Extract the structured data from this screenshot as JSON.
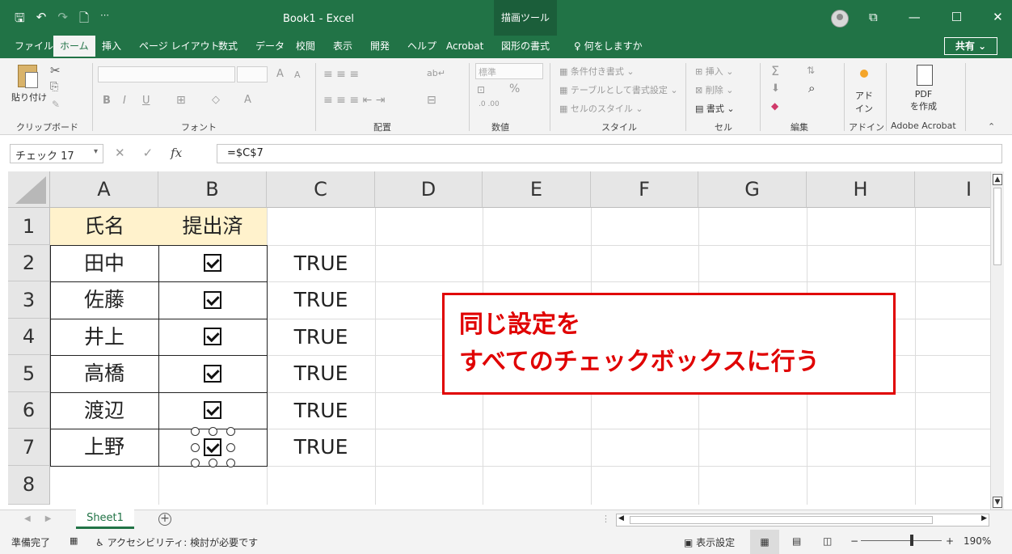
{
  "app": {
    "title": "Book1  -  Excel",
    "draw_tools": "描画ツール",
    "quick_access": {
      "save": "🖫",
      "undo": "↶",
      "redo": "↷",
      "new": "🗋",
      "more": "⋯"
    },
    "window_buttons": {
      "ribbon_display": "⧉",
      "minimize": "—",
      "maximize": "☐",
      "close": "✕"
    }
  },
  "tabs": [
    {
      "label": "ファイル"
    },
    {
      "label": "ホーム"
    },
    {
      "label": "挿入"
    },
    {
      "label": "ページ レイアウト"
    },
    {
      "label": "数式"
    },
    {
      "label": "データ"
    },
    {
      "label": "校閲"
    },
    {
      "label": "表示"
    },
    {
      "label": "開発"
    },
    {
      "label": "ヘルプ"
    },
    {
      "label": "Acrobat"
    },
    {
      "label": "図形の書式"
    }
  ],
  "tell_me": "何をしますか",
  "share": "共有",
  "ribbon": {
    "clipboard": {
      "paste": "貼り付け",
      "label": "クリップボード"
    },
    "font": {
      "label": "フォント",
      "bold": "B",
      "italic": "I",
      "underline": "U",
      "grow": "A",
      "shrink": "A"
    },
    "alignment": {
      "label": "配置"
    },
    "number": {
      "format": "標準",
      "label": "数値",
      "percent": "%"
    },
    "styles": {
      "conditional": "条件付き書式",
      "table": "テーブルとして書式設定",
      "cell_styles": "セルのスタイル",
      "label": "スタイル"
    },
    "cells": {
      "insert": "挿入",
      "delete": "削除",
      "format": "書式",
      "label": "セル"
    },
    "editing": {
      "label": "編集",
      "sum": "Σ"
    },
    "addin": {
      "name": "アド\nイン",
      "label": "アドイン"
    },
    "acrobat": {
      "name": "PDF\nを作成",
      "label": "Adobe Acrobat"
    }
  },
  "formula_bar": {
    "name_box": "チェック 17",
    "cancel": "✕",
    "enter": "✓",
    "fx": "fx",
    "formula": "=$C$7"
  },
  "columns": [
    "A",
    "B",
    "C",
    "D",
    "E",
    "F",
    "G",
    "H",
    "I"
  ],
  "rows": [
    "1",
    "2",
    "3",
    "4",
    "5",
    "6",
    "7",
    "8"
  ],
  "table": {
    "headers": [
      "氏名",
      "提出済"
    ],
    "names": [
      "田中",
      "佐藤",
      "井上",
      "高橋",
      "渡辺",
      "上野"
    ],
    "c_values": [
      "TRUE",
      "TRUE",
      "TRUE",
      "TRUE",
      "TRUE",
      "TRUE"
    ]
  },
  "callout": {
    "line1": "同じ設定を",
    "line2": "すべてのチェックボックスに行う"
  },
  "sheets": [
    {
      "name": "Sheet1"
    }
  ],
  "status": {
    "ready": "準備完了",
    "accessibility": "アクセシビリティ: 検討が必要です",
    "display_settings": "表示設定",
    "zoom": "190%"
  },
  "colors": {
    "excel_green": "#217346",
    "header_fill": "#fff2cc",
    "callout_red": "#e00000"
  }
}
